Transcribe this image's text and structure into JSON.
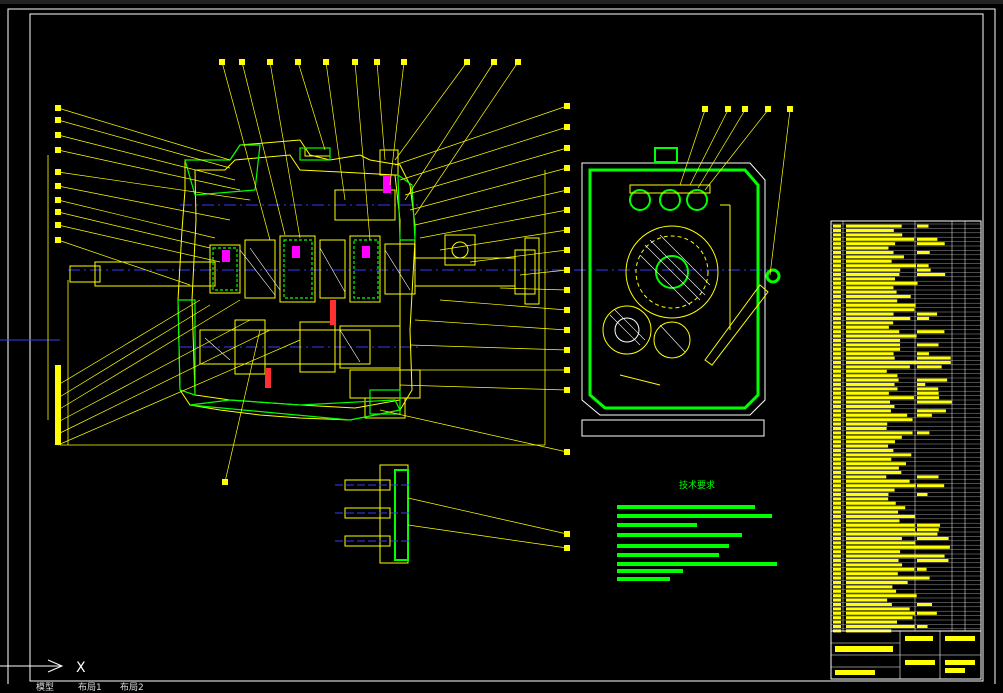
{
  "drawing": {
    "tech_req_title": "技术要求",
    "axis_label": "X",
    "tab_model": "模型",
    "tab_layout1": "布局1",
    "tab_layout2": "布局2",
    "colors": {
      "background": "#000000",
      "geometry": "#ffff00",
      "section": "#00ff00",
      "hatch": "#ffffff",
      "highlight": "#ff00ff",
      "centerline": "#0000ff",
      "frame": "#ffffff"
    }
  }
}
